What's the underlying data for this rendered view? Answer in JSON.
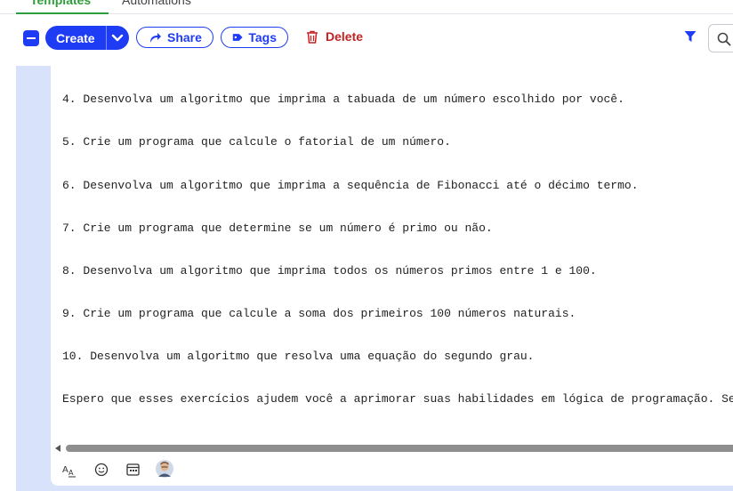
{
  "tabs": [
    {
      "label": "Templates"
    },
    {
      "label": "Automations"
    }
  ],
  "toolbar": {
    "create_label": "Create",
    "share_label": "Share",
    "tags_label": "Tags",
    "delete_label": "Delete"
  },
  "icons": {
    "select_all": "minus-checkbox-icon",
    "create_caret": "chevron-down-icon",
    "share": "share-arrow-icon",
    "tags": "tag-icon",
    "delete": "trash-icon",
    "filter": "filter-icon",
    "search": "search-icon",
    "text_format": "text-format-icon",
    "emoji": "emoji-icon",
    "calendar": "calendar-icon",
    "avatar": "avatar-icon"
  },
  "colors": {
    "accent": "#1f3cf5",
    "danger": "#c72222",
    "tab_active": "#2e9d3b",
    "editor_gutter": "#d8e3fb"
  },
  "editor": {
    "lines": [
      "4. Desenvolva um algoritmo que imprima a tabuada de um número escolhido por você.",
      "5. Crie um programa que calcule o fatorial de um número.",
      "6. Desenvolva um algoritmo que imprima a sequência de Fibonacci até o décimo termo.",
      "7. Crie um programa que determine se um número é primo ou não.",
      "8. Desenvolva um algoritmo que imprima todos os números primos entre 1 e 100.",
      "9. Crie um programa que calcule a soma dos primeiros 100 números naturais.",
      "10. Desenvolva um algoritmo que resolva uma equação do segundo grau.",
      "Espero que esses exercícios ajudem você a aprimorar suas habilidades em lógica de programação. Se"
    ]
  }
}
